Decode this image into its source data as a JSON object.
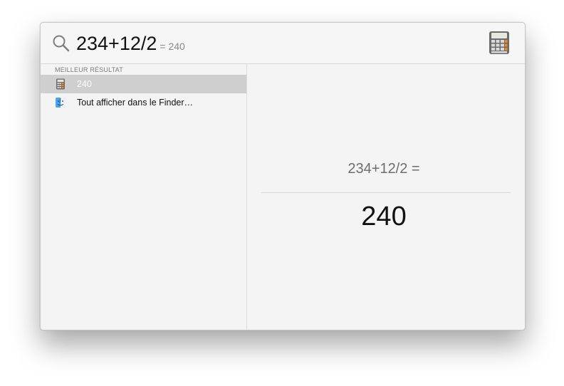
{
  "search": {
    "query": "234+12/2",
    "inline_result": "= 240"
  },
  "results": {
    "section_title": "MEILLEUR RÉSULTAT",
    "items": [
      {
        "label": "240",
        "icon": "calculator-icon",
        "selected": true
      },
      {
        "label": "Tout afficher dans le Finder…",
        "icon": "finder-icon",
        "selected": false
      }
    ]
  },
  "preview": {
    "expression": "234+12/2 =",
    "answer": "240"
  },
  "colors": {
    "selected_row": "#cfcfcf",
    "window_bg": "#f4f4f4",
    "calculator_orange": "#f08a1c"
  }
}
